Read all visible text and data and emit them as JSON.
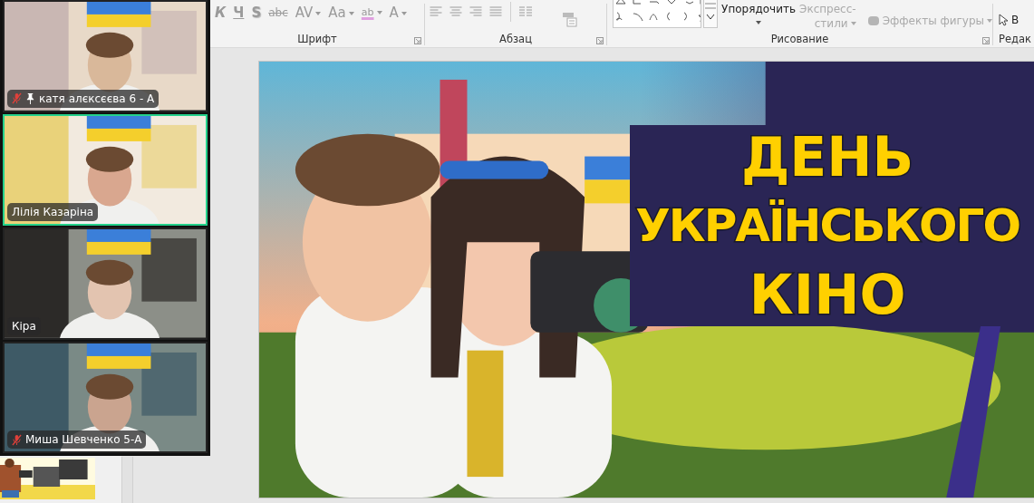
{
  "ribbon": {
    "font_group": {
      "label": "Шрифт",
      "buttons": [
        {
          "label": "К",
          "kind": "italic"
        },
        {
          "label": "Ч",
          "kind": "underline"
        },
        {
          "label": "S",
          "kind": "shadow"
        },
        {
          "label": "abc",
          "kind": "strike"
        },
        {
          "label": "AV",
          "kind": "dropdown"
        },
        {
          "label": "Aa",
          "kind": "dropdown"
        },
        {
          "label": "ab",
          "kind": "highlight"
        },
        {
          "label": "A",
          "kind": "dropdown"
        }
      ]
    },
    "paragraph_group": {
      "label": "Абзац"
    },
    "drawing_group": {
      "label": "Рисование",
      "arrange": "Упорядочить",
      "quick_styles": [
        "Экспресс-",
        "стили"
      ],
      "shape_effects": "Эффекты фигуры"
    },
    "editing_group": {
      "label": "Редак",
      "select": "В"
    }
  },
  "video_tiles": [
    {
      "name": "катя алєксєєва 6 - А",
      "muted": true,
      "pinned": true,
      "speaking": false
    },
    {
      "name": "Лілія Казаріна",
      "muted": false,
      "pinned": false,
      "speaking": true
    },
    {
      "name": "Кіра",
      "muted": false,
      "pinned": false,
      "speaking": false
    },
    {
      "name": "Миша Шевченко 5-А",
      "muted": true,
      "pinned": false,
      "speaking": false
    }
  ],
  "slide": {
    "title_lines": [
      "ДЕНЬ",
      "УКРАЇНСЬКОГО",
      "КІНО"
    ]
  }
}
